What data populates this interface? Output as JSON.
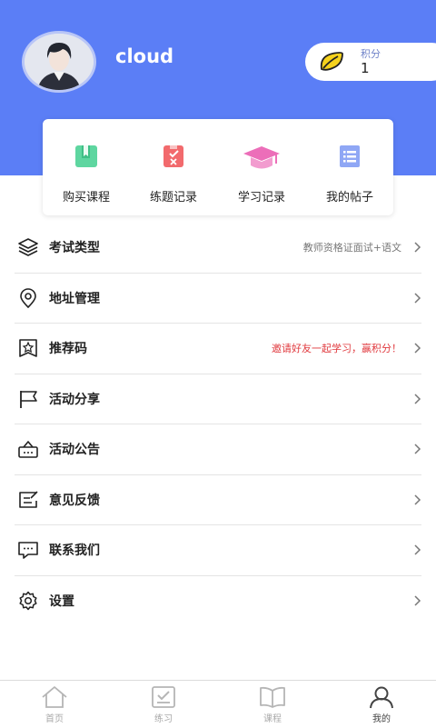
{
  "profile": {
    "username": "cloud",
    "points_label": "积分",
    "points_value": "1"
  },
  "quick_links": [
    {
      "label": "购买课程",
      "icon": "book-icon",
      "color": "#5ed6a0"
    },
    {
      "label": "练题记录",
      "icon": "exercise-record-icon",
      "color": "#f26a6d"
    },
    {
      "label": "学习记录",
      "icon": "graduation-cap-icon",
      "color": "#ec6eb9"
    },
    {
      "label": "我的帖子",
      "icon": "list-icon",
      "color": "#8fa7f5"
    }
  ],
  "menu": [
    {
      "title": "考试类型",
      "extra": "教师资格证面试+语文",
      "icon": "layers-icon"
    },
    {
      "title": "地址管理",
      "extra": "",
      "icon": "location-pin-icon"
    },
    {
      "title": "推荐码",
      "extra": "邀请好友一起学习，赢积分！",
      "icon": "star-badge-icon"
    },
    {
      "title": "活动分享",
      "extra": "",
      "icon": "flag-icon"
    },
    {
      "title": "活动公告",
      "extra": "",
      "icon": "announcement-icon"
    },
    {
      "title": "意见反馈",
      "extra": "",
      "icon": "feedback-icon"
    },
    {
      "title": "联系我们",
      "extra": "",
      "icon": "chat-icon"
    },
    {
      "title": "设置",
      "extra": "",
      "icon": "gear-icon"
    }
  ],
  "tabs": [
    {
      "label": "首页",
      "icon": "home-icon"
    },
    {
      "label": "练习",
      "icon": "practice-icon"
    },
    {
      "label": "课程",
      "icon": "open-book-icon"
    },
    {
      "label": "我的",
      "icon": "user-icon",
      "active": true
    }
  ],
  "colors": {
    "header_blue": "#5b7ef6",
    "highlight_red": "#e0393e"
  }
}
